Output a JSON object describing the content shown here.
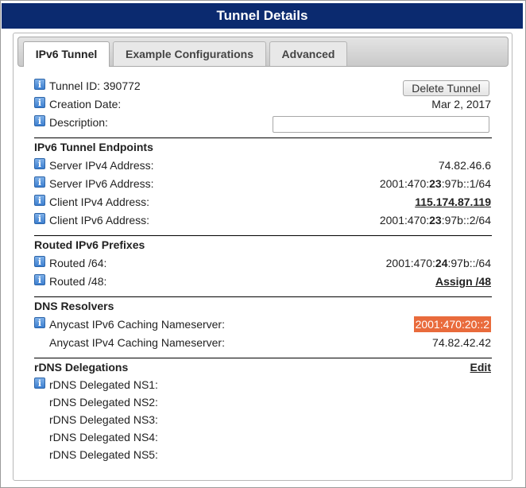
{
  "title": "Tunnel Details",
  "tabs": [
    {
      "label": "IPv6 Tunnel",
      "active": true
    },
    {
      "label": "Example Configurations",
      "active": false
    },
    {
      "label": "Advanced",
      "active": false
    }
  ],
  "general": {
    "tunnel_id_label": "Tunnel ID: 390772",
    "delete_button": "Delete Tunnel",
    "creation_date_label": "Creation Date:",
    "creation_date_value": "Mar 2, 2017",
    "description_label": "Description:",
    "description_value": ""
  },
  "endpoints": {
    "title": "IPv6 Tunnel Endpoints",
    "server_ipv4_label": "Server IPv4 Address:",
    "server_ipv4_value": "74.82.46.6",
    "server_ipv6_label": "Server IPv6 Address:",
    "server_ipv6_pre": "2001:470:",
    "server_ipv6_bold": "23",
    "server_ipv6_post": ":97b::1/64",
    "client_ipv4_label": "Client IPv4 Address:",
    "client_ipv4_value": "115.174.87.119",
    "client_ipv6_label": "Client IPv6 Address:",
    "client_ipv6_pre": "2001:470:",
    "client_ipv6_bold": "23",
    "client_ipv6_post": ":97b::2/64"
  },
  "prefixes": {
    "title": "Routed IPv6 Prefixes",
    "r64_label": "Routed /64:",
    "r64_pre": "2001:470:",
    "r64_bold": "24",
    "r64_post": ":97b::/64",
    "r48_label": "Routed /48:",
    "r48_value": "Assign /48"
  },
  "dns": {
    "title": "DNS Resolvers",
    "v6_label": "Anycast IPv6 Caching Nameserver:",
    "v6_value": "2001:470:20::2",
    "v4_label": "Anycast IPv4 Caching Nameserver:",
    "v4_value": "74.82.42.42"
  },
  "rdns": {
    "title": "rDNS Delegations",
    "edit": "Edit",
    "ns": [
      "rDNS Delegated NS1:",
      "rDNS Delegated NS2:",
      "rDNS Delegated NS3:",
      "rDNS Delegated NS4:",
      "rDNS Delegated NS5:"
    ]
  },
  "icons": {
    "info": "i"
  },
  "colors": {
    "title_bar": "#0b2a6f",
    "highlight": "#e96b3c"
  }
}
